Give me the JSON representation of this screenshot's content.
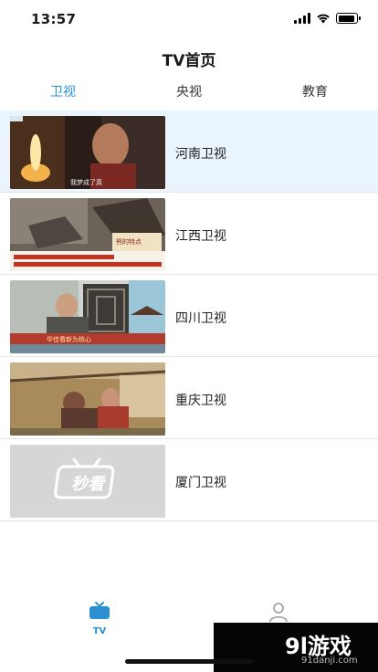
{
  "status_bar": {
    "time": "13:57",
    "battery_level": 0.9
  },
  "nav": {
    "title": "TV首页"
  },
  "tabs": [
    {
      "label": "卫视",
      "active": true
    },
    {
      "label": "央视",
      "active": false
    },
    {
      "label": "教育",
      "active": false
    }
  ],
  "channels": [
    {
      "name": "河南卫视",
      "selected": true,
      "thumb_text": "我梦成了真"
    },
    {
      "name": "江西卫视",
      "selected": false,
      "thumb_text": "熊的特点"
    },
    {
      "name": "四川卫视",
      "selected": false,
      "thumb_text": "华佳看新为核心"
    },
    {
      "name": "重庆卫视",
      "selected": false,
      "thumb_text": ""
    },
    {
      "name": "厦门卫视",
      "selected": false,
      "thumb_text": "秒看"
    }
  ],
  "tab_bar": {
    "tv_label": "TV"
  },
  "watermark": {
    "main": "9l游戏",
    "sub": "91danji.com"
  },
  "colors": {
    "accent": "#2b8fd0",
    "selected_row": "#e9f4fc"
  }
}
